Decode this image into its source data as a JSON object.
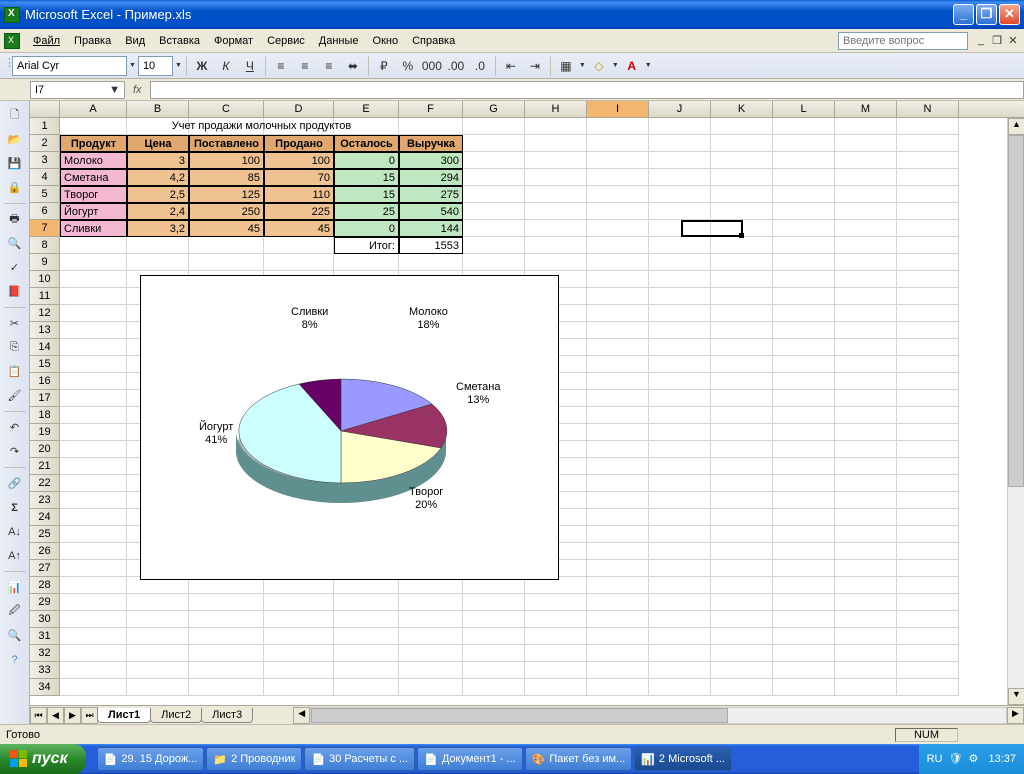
{
  "titlebar": {
    "text": "Microsoft Excel - Пример.xls"
  },
  "menus": [
    "Файл",
    "Правка",
    "Вид",
    "Вставка",
    "Формат",
    "Сервис",
    "Данные",
    "Окно",
    "Справка"
  ],
  "question_placeholder": "Введите вопрос",
  "font": {
    "name": "Arial Cyr",
    "size": "10"
  },
  "name_box": "I7",
  "columns": [
    "A",
    "B",
    "C",
    "D",
    "E",
    "F",
    "G",
    "H",
    "I",
    "J",
    "K",
    "L",
    "M",
    "N"
  ],
  "active_col": "I",
  "active_row": 7,
  "spreadsheet": {
    "title": "Учет продажи молочных продуктов",
    "headers": [
      "Продукт",
      "Цена",
      "Поставлено",
      "Продано",
      "Осталось",
      "Выручка"
    ],
    "rows": [
      {
        "p": "Молоко",
        "c": "3",
        "s": "100",
        "sold": "100",
        "r": "0",
        "rev": "300"
      },
      {
        "p": "Сметана",
        "c": "4,2",
        "s": "85",
        "sold": "70",
        "r": "15",
        "rev": "294"
      },
      {
        "p": "Творог",
        "c": "2,5",
        "s": "125",
        "sold": "110",
        "r": "15",
        "rev": "275"
      },
      {
        "p": "Йогурт",
        "c": "2,4",
        "s": "250",
        "sold": "225",
        "r": "25",
        "rev": "540"
      },
      {
        "p": "Сливки",
        "c": "3,2",
        "s": "45",
        "sold": "45",
        "r": "0",
        "rev": "144"
      }
    ],
    "total_label": "Итог:",
    "total": "1553"
  },
  "chart_data": {
    "type": "pie",
    "title": "",
    "series": [
      {
        "name": "Молоко",
        "value": 18,
        "label": "Молоко\n18%"
      },
      {
        "name": "Сметана",
        "value": 13,
        "label": "Сметана\n13%"
      },
      {
        "name": "Творог",
        "value": 20,
        "label": "Творог\n20%"
      },
      {
        "name": "Йогурт",
        "value": 41,
        "label": "Йогурт\n41%"
      },
      {
        "name": "Сливки",
        "value": 8,
        "label": "Сливки\n8%"
      }
    ],
    "colors": [
      "#9999ff",
      "#993366",
      "#ffffcc",
      "#ccffff",
      "#660066"
    ],
    "style": "3d"
  },
  "sheets": [
    "Лист1",
    "Лист2",
    "Лист3"
  ],
  "active_sheet": "Лист1",
  "status": {
    "ready": "Готово",
    "num": "NUM"
  },
  "taskbar": {
    "start": "пуск",
    "items": [
      {
        "label": "29. 15 Дорож..."
      },
      {
        "label": "2 Проводник"
      },
      {
        "label": "30 Расчеты с ..."
      },
      {
        "label": "Документ1 - ..."
      },
      {
        "label": "Пакет без им..."
      },
      {
        "label": "2 Microsoft ..."
      }
    ],
    "lang": "RU",
    "time": "13:37"
  }
}
